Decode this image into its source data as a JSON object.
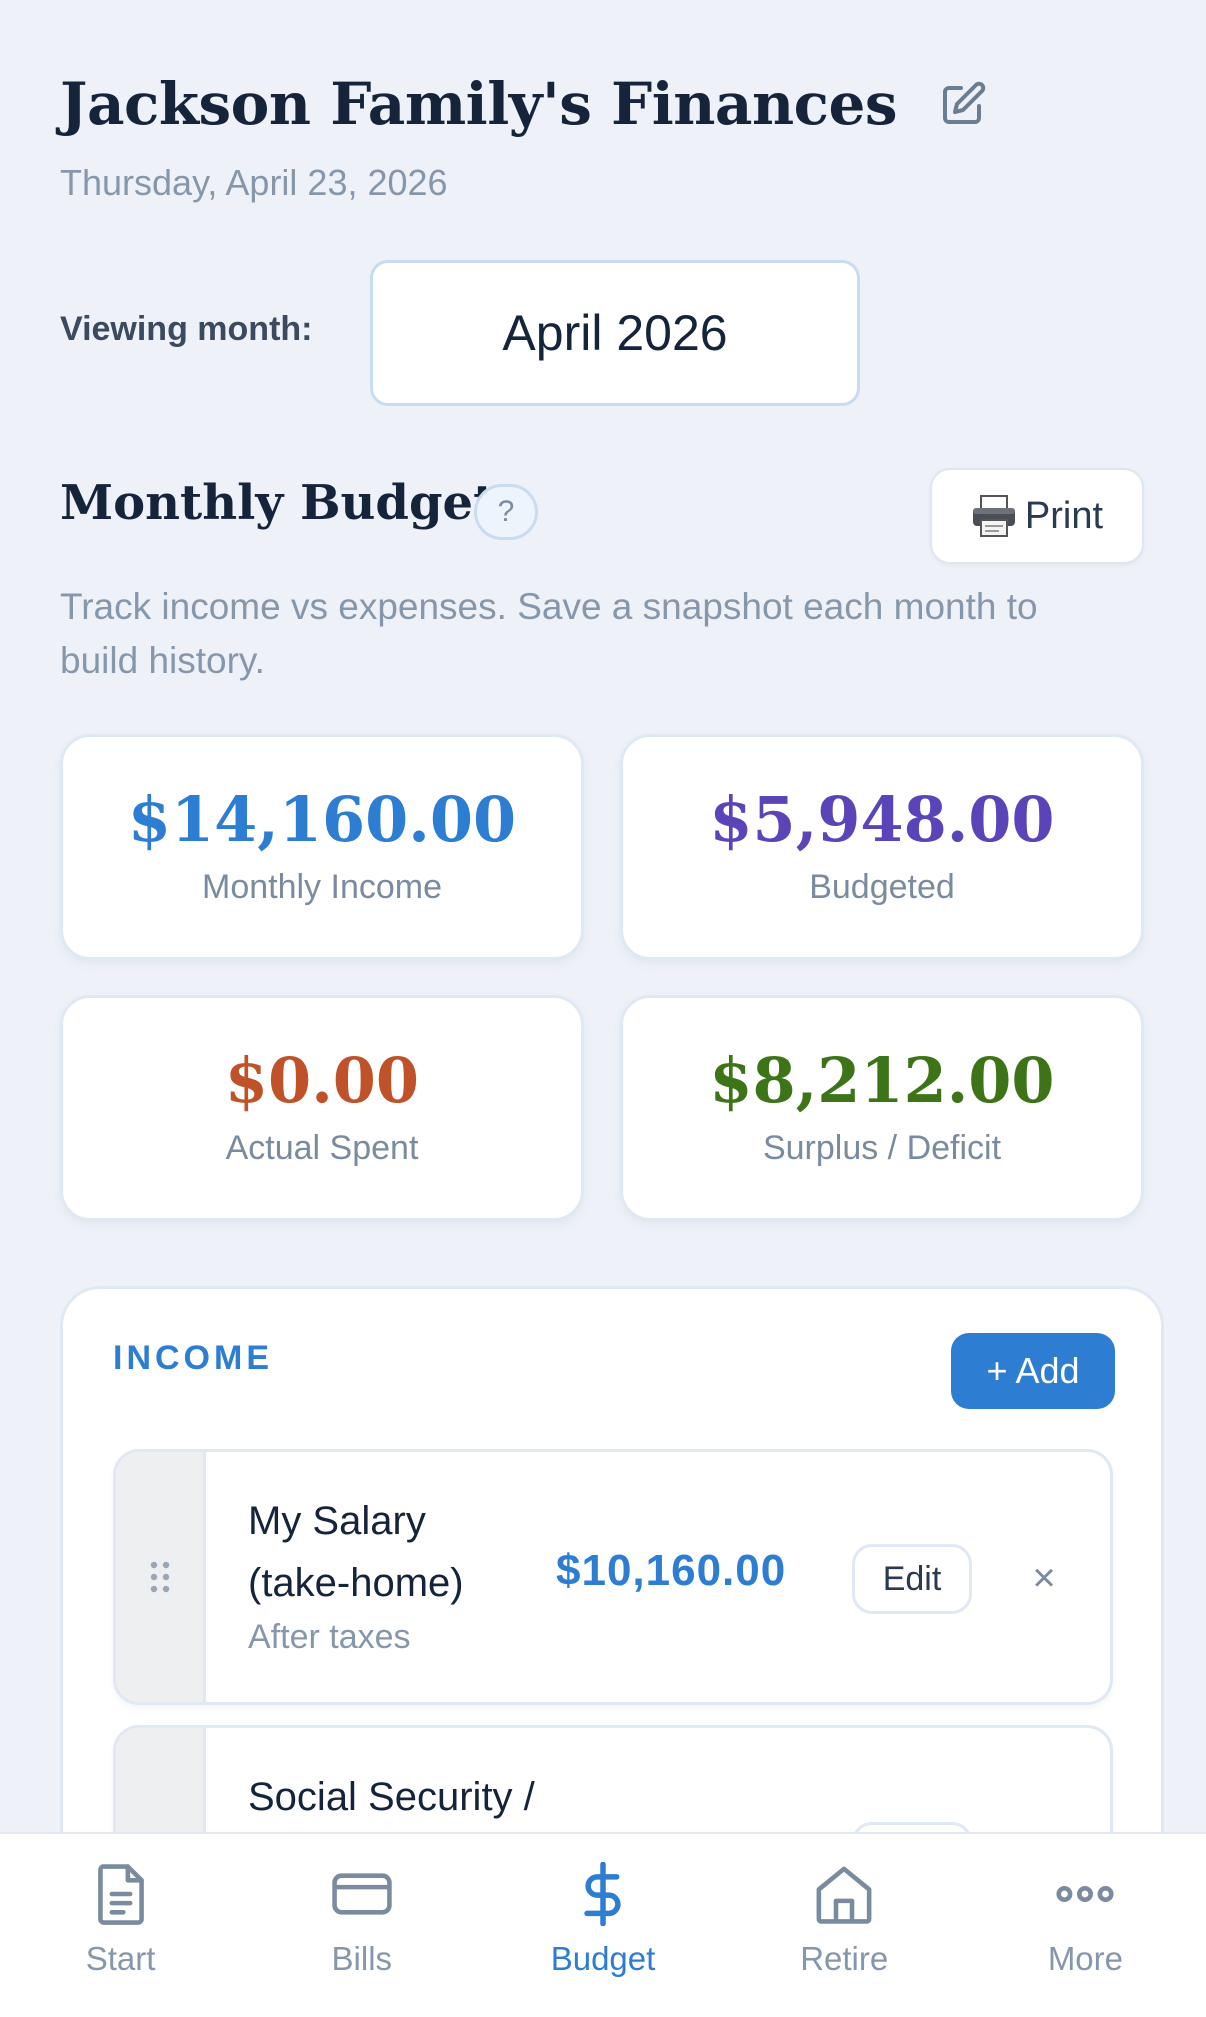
{
  "header": {
    "title": "Jackson Family's Finances",
    "date": "Thursday, April 23, 2026",
    "viewing_month_label": "Viewing month:",
    "viewing_month_value": "April 2026"
  },
  "budget": {
    "title": "Monthly Budget",
    "help_label": "?",
    "print_label": "Print",
    "description": "Track income vs expenses. Save a snapshot each month to build history."
  },
  "stats": [
    {
      "value": "$14,160.00",
      "label": "Monthly Income",
      "color": "#2d7dd2"
    },
    {
      "value": "$5,948.00",
      "label": "Budgeted",
      "color": "#5a44b8"
    },
    {
      "value": "$0.00",
      "label": "Actual Spent",
      "color": "#c0522a"
    },
    {
      "value": "$8,212.00",
      "label": "Surplus / Deficit",
      "color": "#3e7418"
    }
  ],
  "income": {
    "heading": "INCOME",
    "add_label": "+ Add",
    "items": [
      {
        "name": "My Salary (take-home)",
        "note": "After taxes",
        "amount": "$10,160.00",
        "edit_label": "Edit",
        "remove_label": "×"
      },
      {
        "name": "Social Security /",
        "note": "",
        "amount": "",
        "edit_label": "",
        "remove_label": ""
      }
    ]
  },
  "nav": {
    "items": [
      {
        "label": "Start",
        "icon": "document-icon",
        "active": false
      },
      {
        "label": "Bills",
        "icon": "card-icon",
        "active": false
      },
      {
        "label": "Budget",
        "icon": "dollar-icon",
        "active": true
      },
      {
        "label": "Retire",
        "icon": "home-icon",
        "active": false
      },
      {
        "label": "More",
        "icon": "more-dots-icon",
        "active": false
      }
    ]
  },
  "colors": {
    "accent": "#2d7dd2",
    "background": "#eef2f8"
  }
}
